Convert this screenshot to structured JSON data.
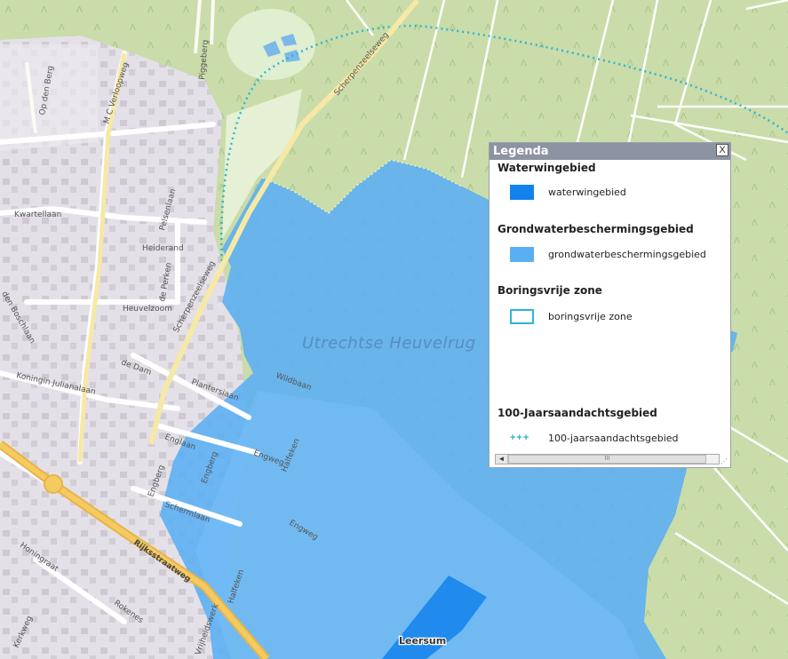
{
  "map": {
    "place_label": "Utrechtse Heuvelrug",
    "town_label": "Leersum",
    "colors": {
      "forest": "#c8dca8",
      "urban": "#e1dce6",
      "waterwingebied": "#1283ec",
      "grondwater": "#5aaef4",
      "boringsvrije_zone": "#2bb6d6",
      "main_road": "#f2c24f"
    },
    "streets": [
      "Op den Berg",
      "M C Verloopweg",
      "Piggeberg",
      "Scherpenzeelseweg",
      "Kwartellaan",
      "Heiderand",
      "Pelsenlaan",
      "de Perken",
      "Heuvelzoom",
      "Scherpenzeelseweg",
      "Wildbaan",
      "de Dam",
      "Koningin Julianalaan",
      "Plantersiaan",
      "Englaan",
      "Engweg",
      "Engberg",
      "Halfeken",
      "Rijksstraatweg",
      "Honingraat",
      "Schermlaan",
      "Rokenes",
      "Kerkweg",
      "Vrijheidswerk",
      "Halfeken",
      "den Boschlaan",
      "Engweg",
      "Engberg"
    ]
  },
  "legend": {
    "title": "Legenda",
    "close_label": "X",
    "sections": [
      {
        "title": "Waterwingebied",
        "item_label": "waterwingebied"
      },
      {
        "title": "Grondwaterbeschermingsgebied",
        "item_label": "grondwaterbeschermingsgebied"
      },
      {
        "title": "Boringsvrije zone",
        "item_label": "boringsvrije zone"
      },
      {
        "title": "100-Jaarsaandachtsgebied",
        "item_label": "100-jaarsaandachtsgebied"
      }
    ],
    "plus_symbol": "+++",
    "scroll_left": "◄",
    "scroll_thumb": "III"
  }
}
